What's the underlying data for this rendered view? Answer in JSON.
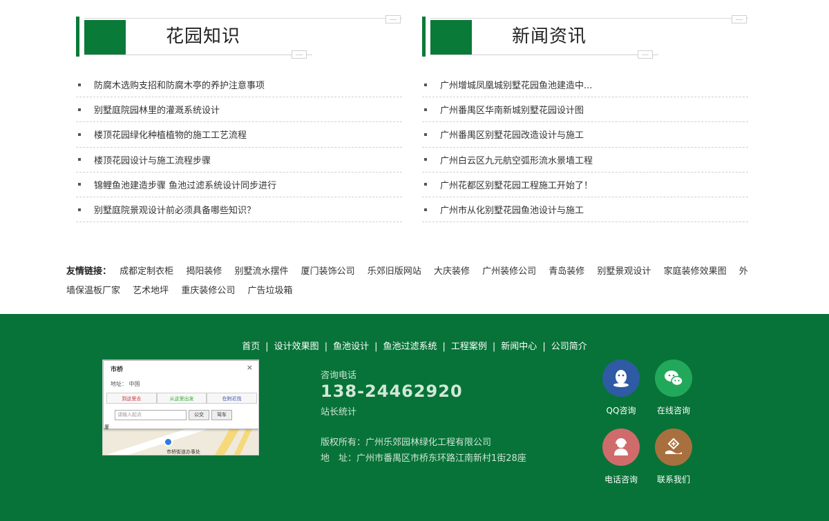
{
  "garden": {
    "title": "花园知识",
    "items": [
      "防腐木选购支招和防腐木亭的养护注意事项",
      "别墅庭院园林里的灌溉系统设计",
      "楼顶花园绿化种植植物的施工工艺流程",
      "楼顶花园设计与施工流程步骤",
      "锦鲤鱼池建造步骤 鱼池过滤系统设计同步进行",
      "别墅庭院景观设计前必须具备哪些知识？"
    ]
  },
  "news": {
    "title": "新闻资讯",
    "items": [
      "广州增城凤凰城别墅花园鱼池建造中...",
      "广州番禺区华南新城别墅花园设计图",
      "广州番禺区别墅花园改造设计与施工",
      "广州白云区九元航空弧形流水景墙工程",
      "广州花都区别墅花园工程施工开始了！",
      "广州市从化别墅花园鱼池设计与施工"
    ]
  },
  "links": {
    "label": "友情链接：",
    "items": [
      "成都定制衣柜",
      "揭阳装修",
      "别墅流水摆件",
      "厦门装饰公司",
      "乐郊旧版网站",
      "大庆装修",
      "广州装修公司",
      "青岛装修",
      "别墅景观设计",
      "家庭装修效果图",
      "外墙保温板厂家",
      "艺术地坪",
      "重庆装修公司",
      "广告垃圾箱"
    ]
  },
  "footer": {
    "nav": [
      "首页",
      "设计效果图",
      "鱼池设计",
      "鱼池过滤系统",
      "工程案例",
      "新闻中心",
      "公司简介"
    ],
    "nav_sep": "|",
    "map": {
      "title": "市桥",
      "close": "×",
      "address": "地址： 中国",
      "tab_to": "到这里去",
      "tab_from": "从这里出发",
      "tab_nearby": "在附近找",
      "input_placeholder": "请输入起点",
      "btn_bus": "公交",
      "btn_car": "驾车",
      "pin_label": "市桥街道办事处",
      "edge_label": "厦"
    },
    "consult_label": "咨询电话",
    "phone": "138-24462920",
    "stats_label": "站长统计",
    "copyright": "版权所有：广州乐郊园林绿化工程有限公司",
    "address": "地　址：广州市番禺区市桥东环路江南新村1街28座",
    "icons": {
      "qq": "QQ咨询",
      "wechat": "在线咨询",
      "tel": "电话咨询",
      "contact": "联系我们"
    }
  },
  "colors": {
    "brand_green": "#0a7a38",
    "footer_bg": "#077338"
  }
}
